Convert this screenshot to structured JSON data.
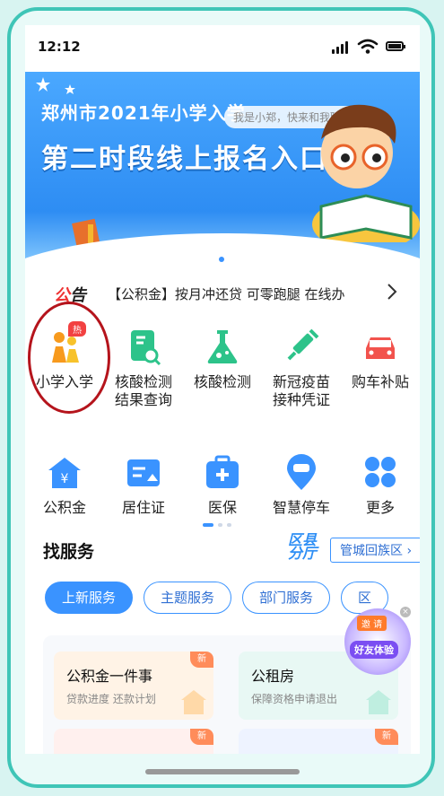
{
  "status": {
    "time": "12:12"
  },
  "banner": {
    "title_line1": "郑州市2021年小学入学",
    "title_line2": "第二时段线上报名入口",
    "chat_bubble": "我是小郑，快来和我聊聊吧"
  },
  "notice": {
    "tag_a": "公",
    "tag_b": "告",
    "text": "【公积金】按月冲还贷 可零跑腿 在线办"
  },
  "grid": [
    {
      "label": "小学入学",
      "icon": "school-kids-icon",
      "badge": "热"
    },
    {
      "label": "核酸检测结果查询",
      "label1": "核酸检测",
      "label2": "结果查询",
      "icon": "test-result-search-icon"
    },
    {
      "label": "核酸检测",
      "icon": "flask-icon"
    },
    {
      "label1": "新冠疫苗",
      "label2": "接种凭证",
      "icon": "syringe-icon"
    },
    {
      "label": "购车补贴",
      "icon": "car-subsidy-icon"
    },
    {
      "label": "公积金",
      "icon": "housing-fund-icon"
    },
    {
      "label": "居住证",
      "icon": "residence-card-icon"
    },
    {
      "label": "医保",
      "icon": "medical-insurance-icon"
    },
    {
      "label": "智慧停车",
      "icon": "parking-icon"
    },
    {
      "label": "更多",
      "icon": "more-grid-icon"
    }
  ],
  "find_services": {
    "title": "找服务",
    "district_logo_1": "区县",
    "district_logo_2": "分厅",
    "district": "管城回族区",
    "district_chevron": "›",
    "tabs": [
      "上新服务",
      "主题服务",
      "部门服务",
      "区"
    ]
  },
  "cards": [
    {
      "title": "公积金一件事",
      "sub": "贷款进度  还款计划",
      "badge": "新"
    },
    {
      "title": "公租房",
      "sub": "保障资格申请退出",
      "badge": "新"
    },
    {
      "badge": "新"
    },
    {
      "badge": "新"
    }
  ],
  "promo": {
    "invite": "邀 请",
    "text": "好友体验"
  },
  "colors": {
    "accent": "#3a93ff",
    "frame": "#3fc5b7",
    "hot": "#f24141"
  }
}
